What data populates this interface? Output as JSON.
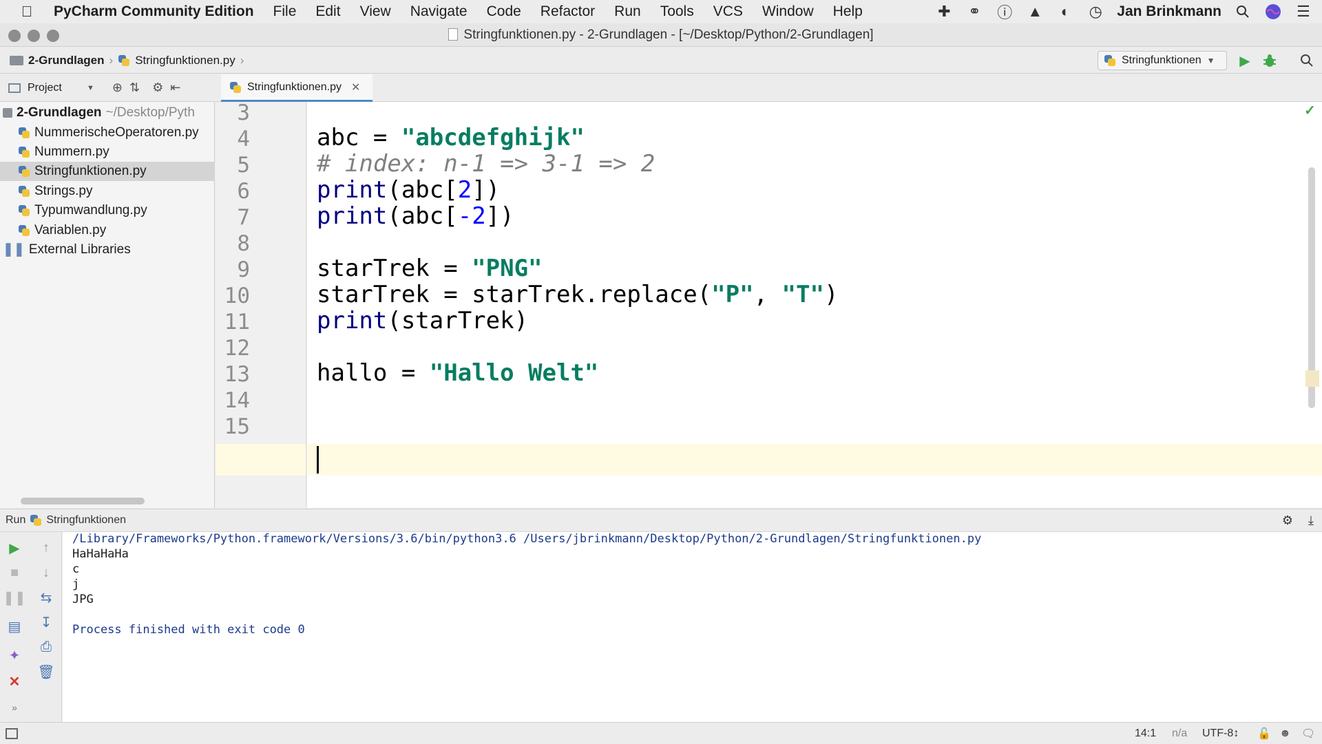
{
  "menubar": {
    "app_name": "PyCharm Community Edition",
    "items": [
      "File",
      "Edit",
      "View",
      "Navigate",
      "Code",
      "Refactor",
      "Run",
      "Tools",
      "VCS",
      "Window",
      "Help"
    ],
    "user": "Jan Brinkmann"
  },
  "window": {
    "title": "Stringfunktionen.py - 2-Grundlagen - [~/Desktop/Python/2-Grundlagen]"
  },
  "navbar": {
    "crumb_project": "2-Grundlagen",
    "crumb_file": "Stringfunktionen.py",
    "run_config": "Stringfunktionen"
  },
  "project": {
    "header_label": "Project",
    "root_name": "2-Grundlagen",
    "root_path": "~/Desktop/Pyth",
    "files": [
      "NummerischeOperatoren.py",
      "Nummern.py",
      "Stringfunktionen.py",
      "Strings.py",
      "Typumwandlung.py",
      "Variablen.py"
    ],
    "external": "External Libraries"
  },
  "editor": {
    "tab_label": "Stringfunktionen.py",
    "line_numbers": [
      "3",
      "4",
      "5",
      "6",
      "7",
      "8",
      "9",
      "10",
      "11",
      "12",
      "13",
      "14",
      "15"
    ],
    "code": {
      "l4_var": "abc",
      "l4_eq": " = ",
      "l4_str": "\"abcdefghijk\"",
      "l5_comment": "# index: n-1 => 3-1 => 2",
      "l6_fn": "print",
      "l6_open": "(abc[",
      "l6_num": "2",
      "l6_close": "])",
      "l7_fn": "print",
      "l7_open": "(abc[",
      "l7_num": "-2",
      "l7_close": "])",
      "l9_var": "starTrek = ",
      "l9_str": "\"PNG\"",
      "l10_a": "starTrek = starTrek.replace(",
      "l10_s1": "\"P\"",
      "l10_comma": ", ",
      "l10_s2": "\"T\"",
      "l10_close": ")",
      "l11_fn": "print",
      "l11_rest": "(starTrek)",
      "l13_var": "hallo = ",
      "l13_str": "\"Hallo Welt\""
    }
  },
  "run": {
    "label": "Run",
    "config": "Stringfunktionen",
    "lines": [
      "/Library/Frameworks/Python.framework/Versions/3.6/bin/python3.6 /Users/jbrinkmann/Desktop/Python/2-Grundlagen/Stringfunktionen.py",
      "HaHaHaHa",
      "c",
      "j",
      "JPG",
      "",
      "Process finished with exit code 0"
    ]
  },
  "status": {
    "position": "14:1",
    "na": "n/a",
    "encoding": "UTF-8↕"
  }
}
